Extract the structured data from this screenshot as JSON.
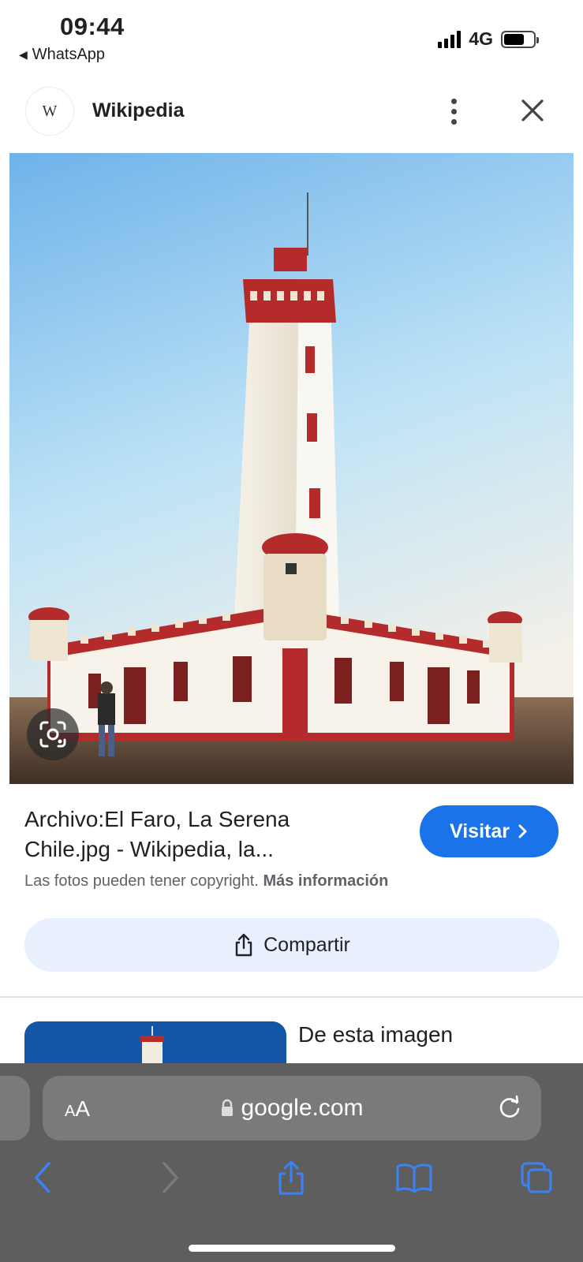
{
  "status": {
    "time": "09:44",
    "back_app": "WhatsApp",
    "network": "4G"
  },
  "header": {
    "logo_letter": "W",
    "site_name": "Wikipedia"
  },
  "result": {
    "title_line1": "Archivo:El Faro, La Serena",
    "title_line2": "Chile.jpg - Wikipedia, la...",
    "visit_label": "Visitar",
    "copyright_text": "Las fotos pueden tener copyright.",
    "more_info": "Más información",
    "share_label": "Compartir"
  },
  "related": {
    "heading": "De esta imagen"
  },
  "browser": {
    "aa_small": "A",
    "aa_large": "A",
    "url": "google.com"
  },
  "colors": {
    "accent": "#1a73e8",
    "share_bg": "#e8f0fe",
    "toolbar_bg": "#5e5e5e",
    "toolbar_icon": "#3b82f6"
  },
  "icons": {
    "more": "more-vert-icon",
    "close": "close-icon",
    "lens": "google-lens-icon",
    "share": "share-icon",
    "lock": "lock-icon",
    "reload": "reload-icon",
    "back": "chevron-left-icon",
    "forward": "chevron-right-icon",
    "bookmarks": "book-icon",
    "tabs": "tabs-icon"
  }
}
